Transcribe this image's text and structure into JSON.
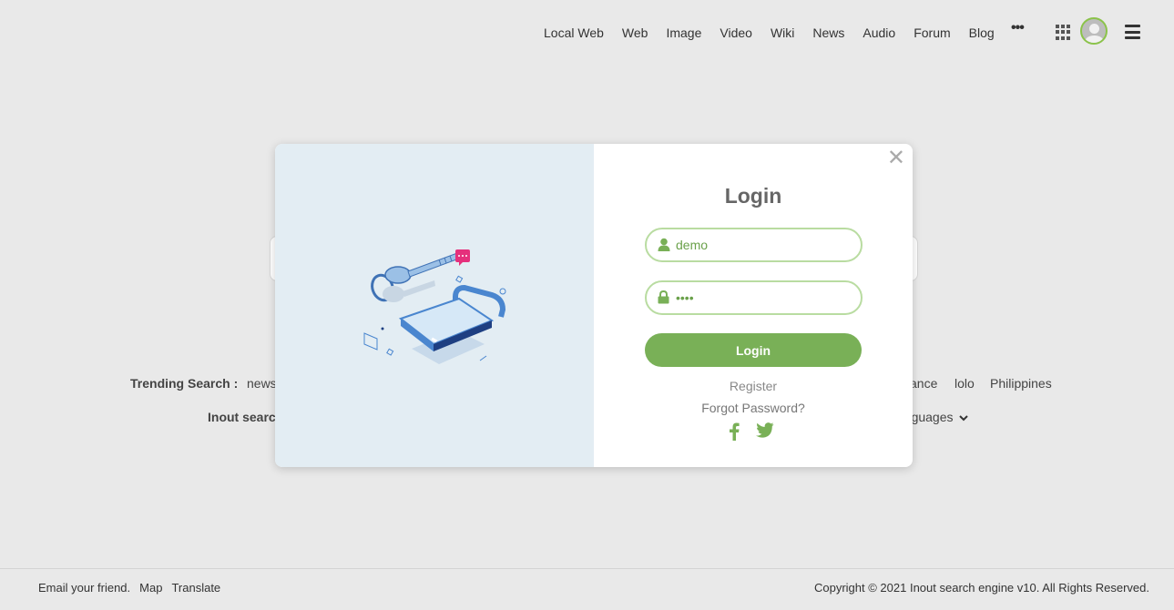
{
  "nav": {
    "links": [
      "Local Web",
      "Web",
      "Image",
      "Video",
      "Wiki",
      "News",
      "Audio",
      "Forum",
      "Blog"
    ],
    "more_label": "•••"
  },
  "trending": {
    "label": "Trending Search :",
    "visible_left": "news",
    "visible_right": [
      "ance",
      "lolo",
      "Philippines"
    ]
  },
  "inout": {
    "label": "Inout search",
    "languages_label": "anguages"
  },
  "modal": {
    "title": "Login",
    "close_glyph": "✕",
    "username_value": "demo",
    "password_value": "••••",
    "login_button": "Login",
    "register_link": "Register",
    "forgot_link": "Forgot Password?"
  },
  "footer": {
    "links": [
      "Email your friend.",
      "Map",
      "Translate"
    ],
    "copyright": "Copyright © 2021 Inout search engine v10. All Rights Reserved."
  },
  "colors": {
    "accent": "#79b057",
    "field_border": "#b9dca1",
    "background": "#e9e9e9",
    "illustration_bg": "#e3edf3"
  }
}
